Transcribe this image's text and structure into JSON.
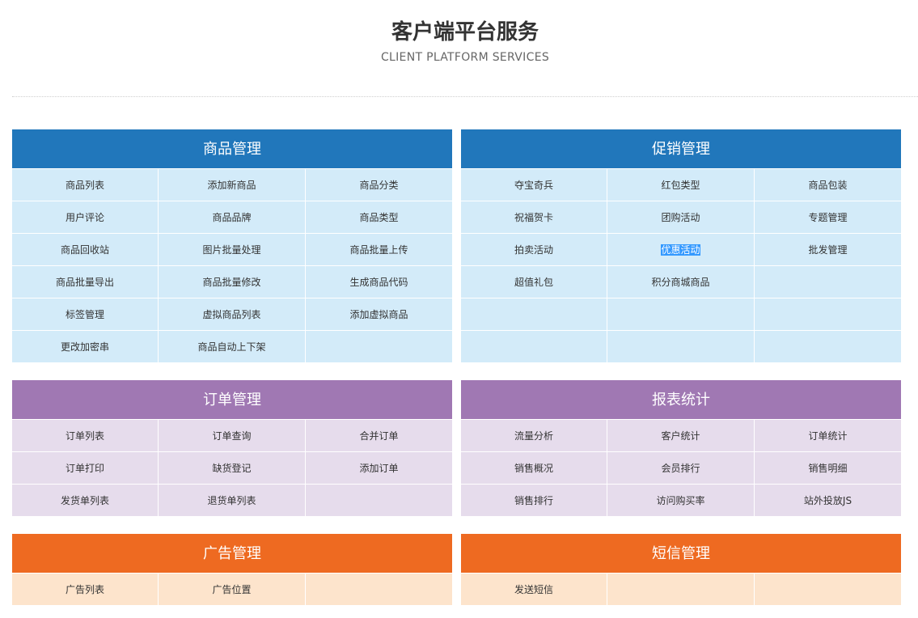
{
  "header": {
    "title": "客户端平台服务",
    "subtitle": "CLIENT PLATFORM SERVICES"
  },
  "panels": [
    {
      "id": "goods",
      "title": "商品管理",
      "color": "#2177bb",
      "cell_color": "#d3ebf9",
      "items": [
        "商品列表",
        "添加新商品",
        "商品分类",
        "用户评论",
        "商品品牌",
        "商品类型",
        "商品回收站",
        "图片批量处理",
        "商品批量上传",
        "商品批量导出",
        "商品批量修改",
        "生成商品代码",
        "标签管理",
        "虚拟商品列表",
        "添加虚拟商品",
        "更改加密串",
        "商品自动上下架",
        ""
      ]
    },
    {
      "id": "promotion",
      "title": "促销管理",
      "color": "#2177bb",
      "cell_color": "#d3ebf9",
      "items": [
        "夺宝奇兵",
        "红包类型",
        "商品包装",
        "祝福贺卡",
        "团购活动",
        "专题管理",
        "拍卖活动",
        "优惠活动",
        "批发管理",
        "超值礼包",
        "积分商城商品",
        "",
        "",
        "",
        "",
        "",
        "",
        ""
      ],
      "selected_item": "优惠活动"
    },
    {
      "id": "orders",
      "title": "订单管理",
      "color": "#a078b3",
      "cell_color": "#e6dcec",
      "items": [
        "订单列表",
        "订单查询",
        "合并订单",
        "订单打印",
        "缺货登记",
        "添加订单",
        "发货单列表",
        "退货单列表",
        ""
      ]
    },
    {
      "id": "reports",
      "title": "报表统计",
      "color": "#a078b3",
      "cell_color": "#e6dcec",
      "items": [
        "流量分析",
        "客户统计",
        "订单统计",
        "销售概况",
        "会员排行",
        "销售明细",
        "销售排行",
        "访问购买率",
        "站外投放JS"
      ]
    },
    {
      "id": "ads",
      "title": "广告管理",
      "color": "#ee6a21",
      "cell_color": "#fde4cc",
      "items": [
        "广告列表",
        "广告位置",
        ""
      ]
    },
    {
      "id": "sms",
      "title": "短信管理",
      "color": "#ee6a21",
      "cell_color": "#fde4cc",
      "items": [
        "发送短信",
        "",
        ""
      ]
    }
  ]
}
